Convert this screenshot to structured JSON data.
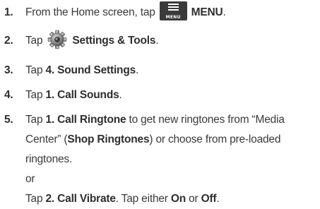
{
  "steps": [
    {
      "num": "1.",
      "pre": "From the Home screen, tap",
      "icon": "menu-icon",
      "icon_label": "MENU",
      "bold": "MENU",
      "post": "."
    },
    {
      "num": "2.",
      "pre": "Tap",
      "icon": "gear-icon",
      "bold": "Settings & Tools",
      "post": "."
    },
    {
      "num": "3.",
      "pre": "Tap",
      "bold": "4. Sound Settings",
      "post": "."
    },
    {
      "num": "4.",
      "pre": "Tap",
      "bold": "1. Call Sounds",
      "post": "."
    },
    {
      "num": "5.",
      "line1_pre": "Tap",
      "line1_bold": "1. Call Ringtone",
      "line1_post": "to get new ringtones from “Media",
      "line2_pre": "Center” (",
      "line2_bold": "Shop Ringtones",
      "line2_post": ") or choose from pre-loaded",
      "line3": "ringtones.",
      "line4": "or",
      "line5_pre": "Tap",
      "line5_bold1": "2. Call Vibrate",
      "line5_mid": ". Tap either",
      "line5_bold2": "On",
      "line5_or": "or",
      "line5_bold3": "Off",
      "line5_post": "."
    }
  ]
}
